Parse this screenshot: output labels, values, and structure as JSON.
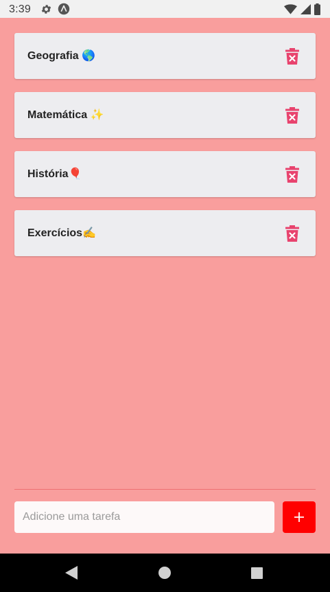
{
  "status_bar": {
    "time": "3:39",
    "icons": [
      "gear-icon",
      "react-native-icon",
      "wifi-icon",
      "signal-icon",
      "battery-icon"
    ]
  },
  "tasks": [
    {
      "label": "Geografia",
      "emoji": "🌎"
    },
    {
      "label": "Matemática",
      "emoji": "✨"
    },
    {
      "label": "História",
      "emoji": "🎈"
    },
    {
      "label": "Exercícios",
      "emoji": "✍️"
    }
  ],
  "input": {
    "placeholder": "Adicione uma tarefa",
    "value": ""
  },
  "add_button": {
    "label": "+"
  },
  "colors": {
    "background": "#F99E9D",
    "card": "#EDEDF0",
    "delete_icon": "#E8436E",
    "add_button": "#FF0000",
    "divider": "#EE6F72"
  },
  "nav_bar": {
    "icons": [
      "back-icon",
      "home-icon",
      "recents-icon"
    ]
  }
}
